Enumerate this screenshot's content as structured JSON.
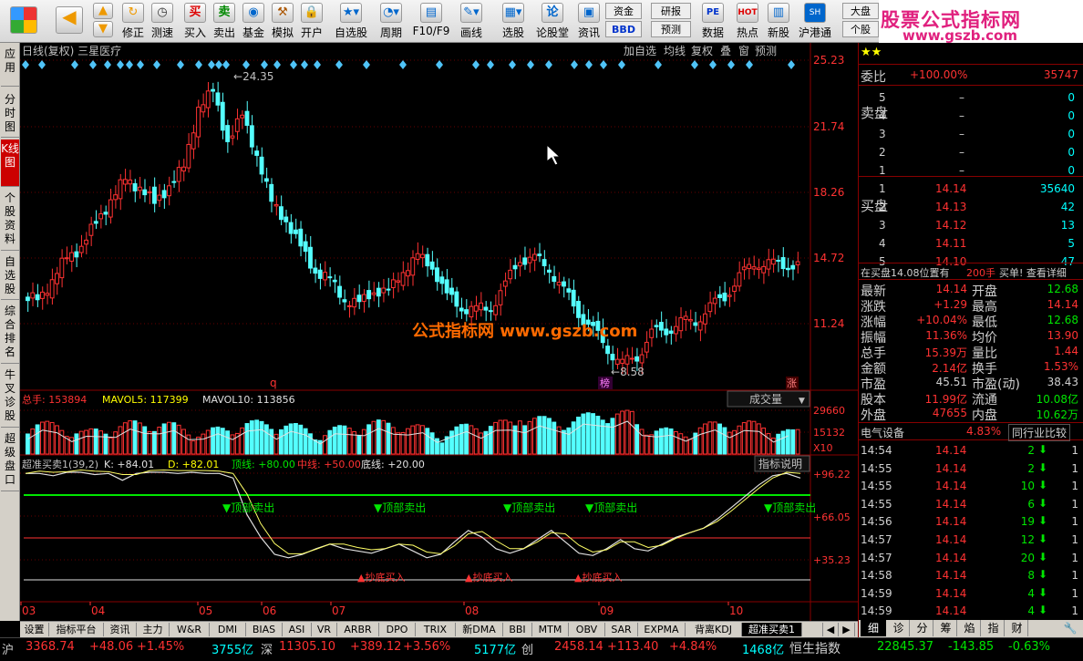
{
  "toolbar": {
    "items": [
      "修正",
      "测速",
      "买入",
      "卖出",
      "基金",
      "模拟",
      "开户",
      "自选股",
      "周期",
      "F10/F9",
      "画线",
      "选股",
      "论股堂",
      "资讯",
      "数据",
      "热点",
      "新股",
      "沪港通"
    ],
    "zijin": "资金",
    "bbd": "BBD",
    "yanbao": "研报",
    "yuce": "预测",
    "pe": "PE",
    "hot": "HOT",
    "dapan": "大盘",
    "gegu": "个股"
  },
  "brand": {
    "title": "股票公式指标网",
    "url": "www.gszb.com"
  },
  "left_tabs": [
    "应用",
    "分时图",
    "K线图",
    "个股资料",
    "自选股",
    "综合排名",
    "牛叉诊股",
    "超级盘口"
  ],
  "chart": {
    "title": "日线(复权)  三星医疗",
    "buttons": [
      "加自选",
      "均线",
      "复权",
      "叠",
      "窗",
      "预测"
    ],
    "price_ticks": [
      "25.23",
      "21.74",
      "18.26",
      "14.72",
      "11.24"
    ],
    "high_label": "24.35",
    "low_label": "8.58",
    "watermark": "公式指标网  www.gszb.com",
    "q_mark": "q",
    "zhang_mark": "涨",
    "bang_mark": "榜",
    "vol_header": {
      "total": "总手: 153894",
      "ma5": "MAVOL5: 117399",
      "ma10": "MAVOL10: 113856"
    },
    "vol_ticks": [
      "29660",
      "15132",
      "X10"
    ],
    "vol_button": "成交量",
    "ind_header": {
      "name": "超准买卖1(39,2)",
      "k": "K: +84.01",
      "d": "D: +82.01",
      "top": "顶线: +80.00",
      "mid": "中线: +50.00",
      "bottom": "底线: +20.00"
    },
    "ind_button": "指标说明",
    "ind_ticks": [
      "+96.22",
      "+66.05",
      "+35.23"
    ],
    "sell_labels": [
      "顶部卖出",
      "顶部卖出",
      "顶部卖出",
      "顶部卖出",
      "顶部卖出"
    ],
    "buy_labels": [
      "抄底买入",
      "抄底买入",
      "抄底买入"
    ],
    "months": [
      "03",
      "04",
      "05",
      "06",
      "07",
      "08",
      "09",
      "10"
    ]
  },
  "bottom_tabs": [
    "设置",
    "指标平台",
    "资讯",
    "主力",
    "W&R",
    "DMI",
    "BIAS",
    "ASI",
    "VR",
    "ARBR",
    "DPO",
    "TRIX",
    "新DMA",
    "BBI",
    "MTM",
    "OBV",
    "SAR",
    "EXPMA",
    "背离KDJ",
    "超准买卖1"
  ],
  "right_tabs": [
    "细",
    "诊",
    "分",
    "筹",
    "焰",
    "指",
    "财"
  ],
  "status": {
    "sh": "沪",
    "sh_idx": "3368.74",
    "sh_chg": "+48.06",
    "sh_pct": "+1.45%",
    "sh_amt": "3755亿",
    "sz": "深",
    "sz_idx": "11305.10",
    "sz_chg": "+389.12",
    "sz_pct": "+3.56%",
    "sz_amt": "5177亿",
    "cy": "创",
    "cy_idx": "2458.14",
    "cy_chg": "+113.40",
    "cy_pct": "+4.84%",
    "hs_amt": "1468亿",
    "hs": "恒生指数",
    "hs_idx": "22845.37",
    "hs_chg": "-143.85",
    "hs_pct": "-0.63%"
  },
  "quote": {
    "weibi": "委比",
    "weibi_val": "+100.00%",
    "weibi_cha": "35747",
    "sell_side": "卖盘",
    "buy_side": "买盘",
    "sells": [
      {
        "n": "5",
        "p": "–",
        "v": "0"
      },
      {
        "n": "4",
        "p": "–",
        "v": "0"
      },
      {
        "n": "3",
        "p": "–",
        "v": "0"
      },
      {
        "n": "2",
        "p": "–",
        "v": "0"
      },
      {
        "n": "1",
        "p": "–",
        "v": "0"
      }
    ],
    "buys": [
      {
        "n": "1",
        "p": "14.14",
        "v": "35640"
      },
      {
        "n": "2",
        "p": "14.13",
        "v": "42"
      },
      {
        "n": "3",
        "p": "14.12",
        "v": "13"
      },
      {
        "n": "4",
        "p": "14.11",
        "v": "5"
      },
      {
        "n": "5",
        "p": "14.10",
        "v": "47"
      }
    ],
    "queue": "在买盘14.08位置有",
    "queue_vol": "200手",
    "queue_act": "买单! 查看详细",
    "stats": [
      [
        "最新",
        "14.14",
        "开盘",
        "12.68"
      ],
      [
        "涨跌",
        "+1.29",
        "最高",
        "14.14"
      ],
      [
        "涨幅",
        "+10.04%",
        "最低",
        "12.68"
      ],
      [
        "振幅",
        "11.36%",
        "均价",
        "13.90"
      ],
      [
        "总手",
        "15.39万",
        "量比",
        "1.44"
      ],
      [
        "金额",
        "2.14亿",
        "换手",
        "1.53%"
      ],
      [
        "市盈",
        "45.51",
        "市盈(动)",
        "38.43"
      ],
      [
        "股本",
        "11.99亿",
        "流通",
        "10.08亿"
      ],
      [
        "外盘",
        "47655",
        "内盘",
        "10.62万"
      ]
    ],
    "sector": "电气设备",
    "sector_pct": "4.83%",
    "sector_btn": "同行业比较",
    "ticks": [
      [
        "14:54",
        "14.14",
        "2",
        "1"
      ],
      [
        "14:55",
        "14.14",
        "2",
        "1"
      ],
      [
        "14:55",
        "14.14",
        "10",
        "1"
      ],
      [
        "14:55",
        "14.14",
        "6",
        "1"
      ],
      [
        "14:56",
        "14.14",
        "19",
        "1"
      ],
      [
        "14:57",
        "14.14",
        "12",
        "1"
      ],
      [
        "14:57",
        "14.14",
        "20",
        "1"
      ],
      [
        "14:58",
        "14.14",
        "8",
        "1"
      ],
      [
        "14:59",
        "14.14",
        "4",
        "1"
      ],
      [
        "14:59",
        "14.14",
        "4",
        "1"
      ]
    ]
  }
}
